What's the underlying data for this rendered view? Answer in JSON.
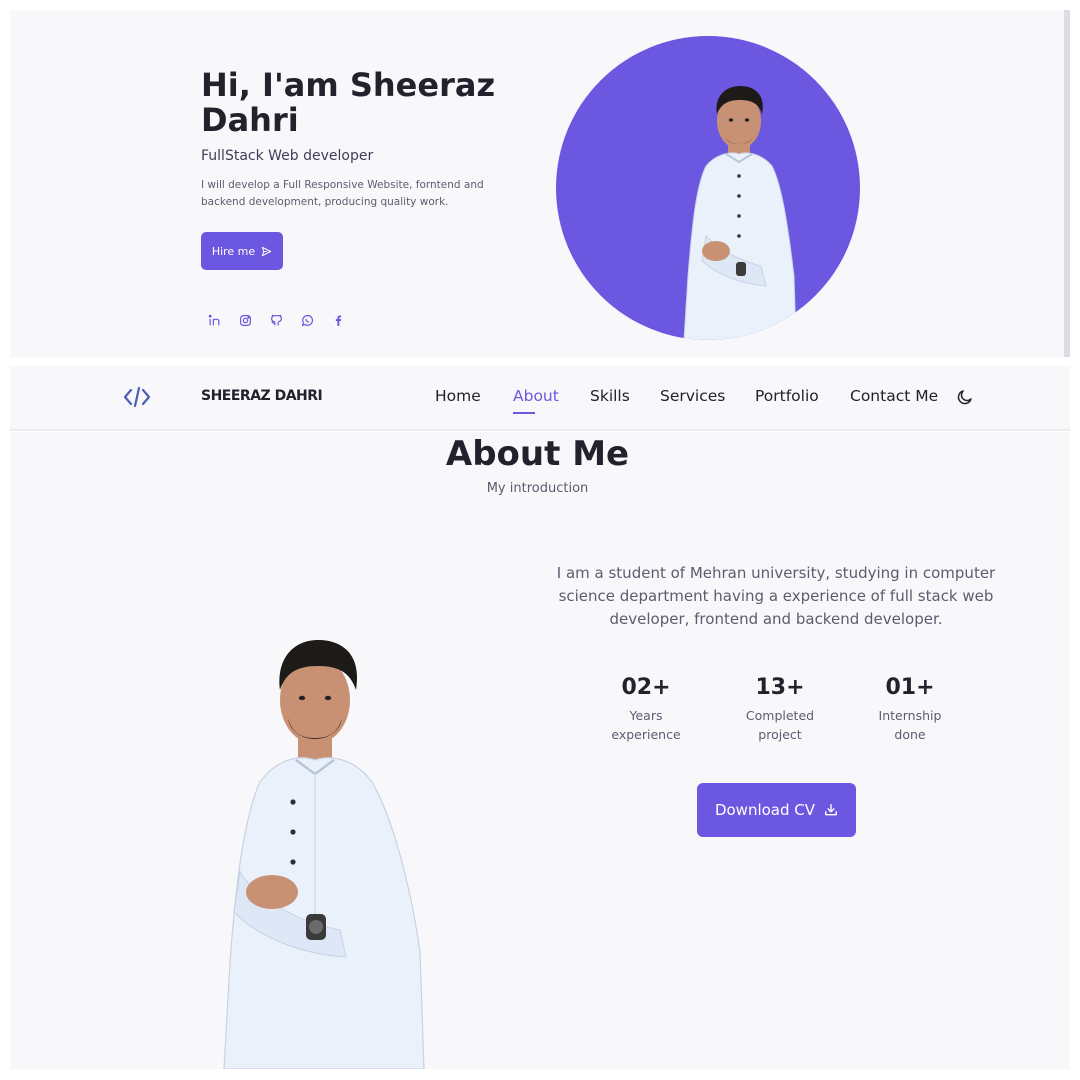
{
  "colors": {
    "accent": "#6c57e0",
    "background": "#f8f8fb",
    "text": "#22212c",
    "muted": "#5d5b6e"
  },
  "hero": {
    "title": "Hi, I'am Sheeraz Dahri",
    "subtitle": "FullStack Web developer",
    "description": "I will develop a Full Responsive Website, forntend and backend development, producing quality work.",
    "hire_button": "Hire me",
    "hire_icon": "send-icon",
    "socials": [
      "linkedin-icon",
      "instagram-icon",
      "github-icon",
      "whatsapp-icon",
      "facebook-icon"
    ]
  },
  "nav": {
    "logo_icon": "code-icon",
    "brand": "SHEERAZ DAHRI",
    "links": [
      "Home",
      "About",
      "Skills",
      "Services",
      "Portfolio",
      "Contact Me"
    ],
    "active": "About",
    "theme_icon": "moon-icon"
  },
  "about": {
    "title": "About Me",
    "subtitle": "My introduction",
    "description": "I am a student of Mehran university, studying in computer science department having a experience of full stack web developer, frontend and backend developer.",
    "stats": [
      {
        "number": "02+",
        "label": "Years\nexperience"
      },
      {
        "number": "13+",
        "label": "Completed\nproject"
      },
      {
        "number": "01+",
        "label": "Internship\ndone"
      }
    ],
    "cv_button": "Download CV",
    "cv_icon": "download-icon"
  }
}
